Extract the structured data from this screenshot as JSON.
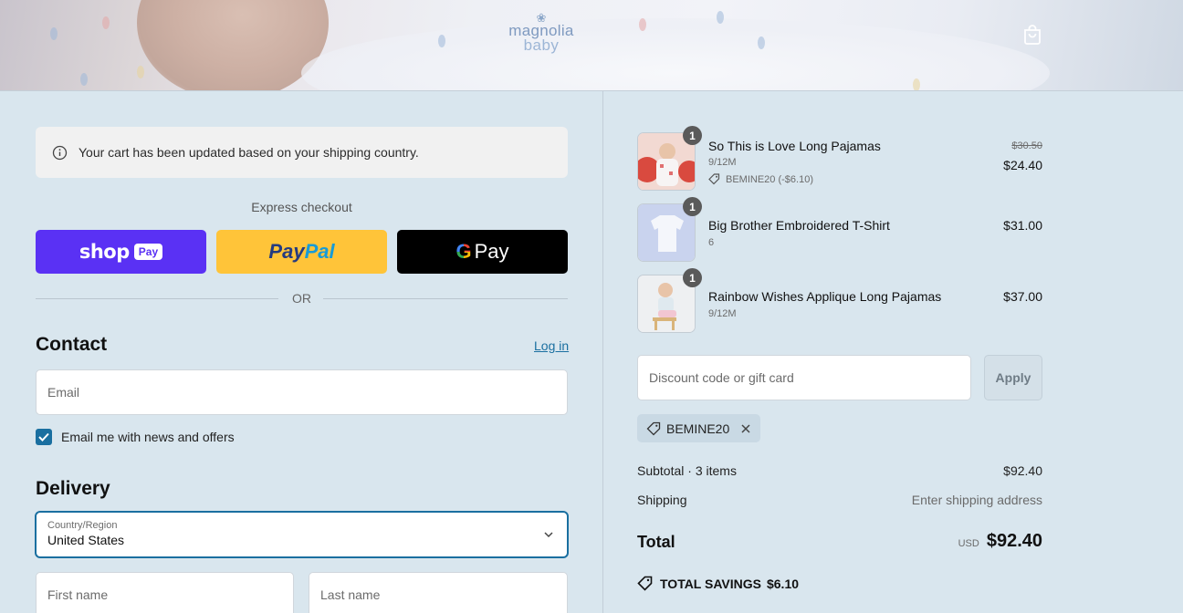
{
  "header": {
    "logo_line1": "magnolia",
    "logo_line2": "baby"
  },
  "notice": {
    "text": "Your cart has been updated based on your shipping country."
  },
  "express": {
    "label": "Express checkout",
    "shop_word": "shop",
    "shop_badge": "Pay",
    "paypal_part1": "Pay",
    "paypal_part2": "Pal",
    "gpay_g": "G",
    "gpay_word": "Pay",
    "or": "OR"
  },
  "contact": {
    "title": "Contact",
    "login": "Log in",
    "email_placeholder": "Email",
    "newsletter_label": "Email me with news and offers",
    "newsletter_checked": true
  },
  "delivery": {
    "title": "Delivery",
    "country_label": "Country/Region",
    "country_value": "United States",
    "first_name_placeholder": "First name",
    "last_name_placeholder": "Last name"
  },
  "cart": {
    "items": [
      {
        "name": "So This is Love Long Pajamas",
        "variant": "9/12M",
        "qty": "1",
        "old_price": "$30.50",
        "price": "$24.40",
        "discount": "BEMINE20 (-$6.10)"
      },
      {
        "name": "Big Brother Embroidered T-Shirt",
        "variant": "6",
        "qty": "1",
        "price": "$31.00"
      },
      {
        "name": "Rainbow Wishes Applique Long Pajamas",
        "variant": "9/12M",
        "qty": "1",
        "price": "$37.00"
      }
    ],
    "discount_placeholder": "Discount code or gift card",
    "apply": "Apply",
    "applied_code": "BEMINE20",
    "subtotal_label": "Subtotal · 3 items",
    "subtotal_value": "$92.40",
    "shipping_label": "Shipping",
    "shipping_value": "Enter shipping address",
    "total_label": "Total",
    "currency": "USD",
    "total_value": "$92.40",
    "savings_label": "TOTAL SAVINGS",
    "savings_value": "$6.10"
  },
  "colors": {
    "background": "#d9e6ee",
    "accent": "#1a6fa0",
    "shop_pay": "#5a31f4",
    "paypal": "#ffc439"
  }
}
